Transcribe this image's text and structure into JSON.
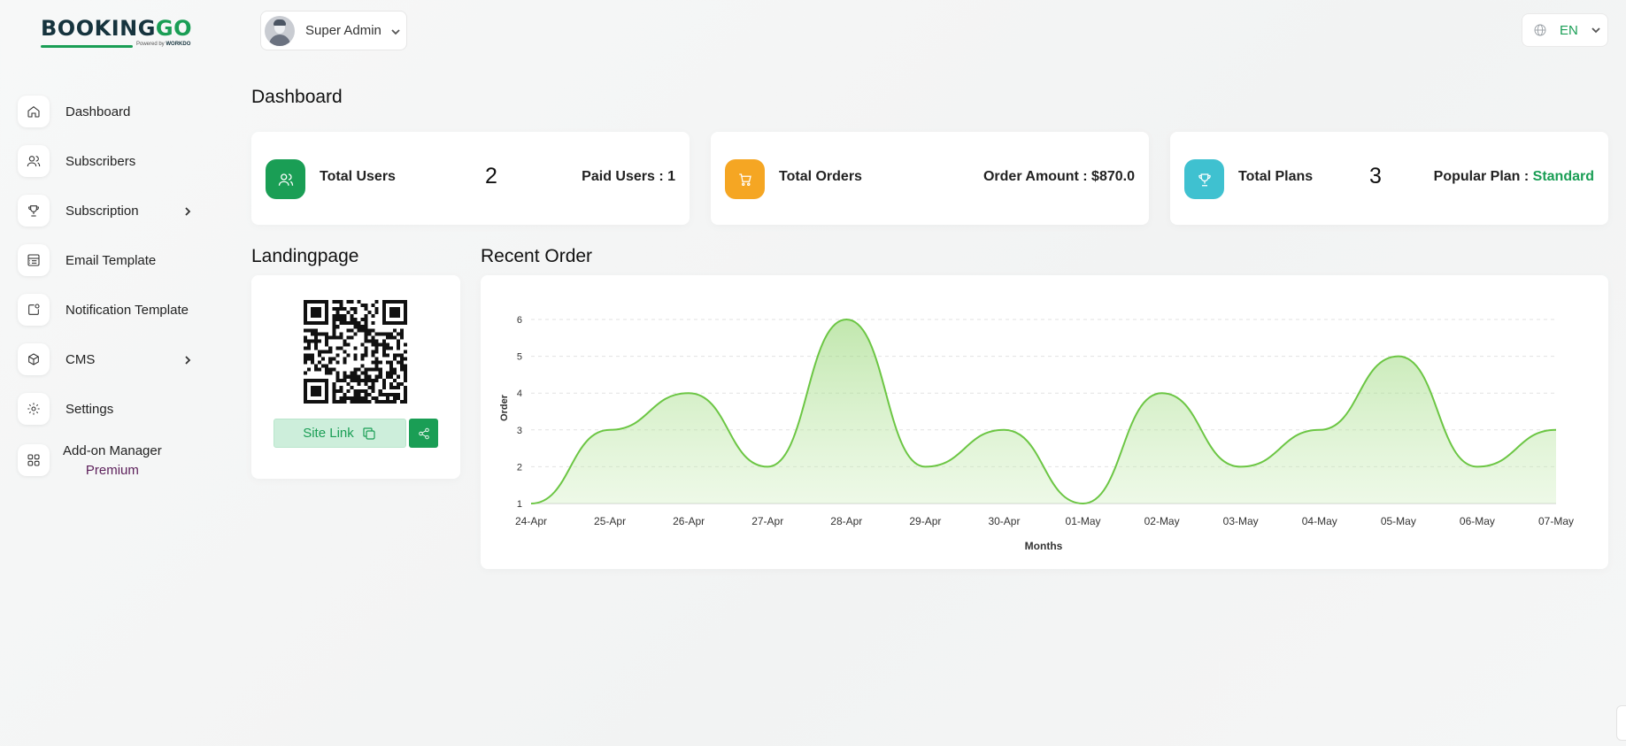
{
  "brand": {
    "logo_main": "BOOKING",
    "logo_accent": "GO",
    "powered_by": "Powered by",
    "powered_brand": "WORKDO"
  },
  "sidebar": {
    "items": [
      {
        "label": "Dashboard",
        "icon": "home-icon"
      },
      {
        "label": "Subscribers",
        "icon": "users-icon"
      },
      {
        "label": "Subscription",
        "icon": "trophy-icon",
        "has_submenu": true
      },
      {
        "label": "Email Template",
        "icon": "template-icon"
      },
      {
        "label": "Notification Template",
        "icon": "notification-icon"
      },
      {
        "label": "CMS",
        "icon": "box-icon",
        "has_submenu": true
      },
      {
        "label": "Settings",
        "icon": "gear-icon"
      }
    ],
    "addon": {
      "label": "Add-on Manager",
      "badge": "Premium",
      "icon": "grid-icon"
    }
  },
  "header": {
    "user_name": "Super Admin",
    "language": "EN"
  },
  "page_title": "Dashboard",
  "stats": {
    "users": {
      "label": "Total Users",
      "value": "2",
      "right": "Paid Users : 1",
      "color": "#1a9e55"
    },
    "orders": {
      "label": "Total Orders",
      "right": "Order Amount : $870.0",
      "color": "#f5a623"
    },
    "plans": {
      "label": "Total Plans",
      "value": "3",
      "right_prefix": "Popular Plan : ",
      "right_value": "Standard",
      "color": "#3fc1d0"
    }
  },
  "landing": {
    "title": "Landingpage",
    "site_link_label": "Site Link"
  },
  "recent_order": {
    "title": "Recent Order"
  },
  "chart_data": {
    "type": "area",
    "title": "Recent Order",
    "xlabel": "Months",
    "ylabel": "Order",
    "x": [
      "24-Apr",
      "25-Apr",
      "26-Apr",
      "27-Apr",
      "28-Apr",
      "29-Apr",
      "30-Apr",
      "01-May",
      "02-May",
      "03-May",
      "04-May",
      "05-May",
      "06-May",
      "07-May"
    ],
    "series": [
      {
        "values": [
          1,
          3,
          4,
          2,
          6,
          2,
          3,
          1,
          4,
          2,
          3,
          5,
          2,
          3
        ]
      }
    ],
    "yticks": [
      1,
      2,
      3,
      4,
      5,
      6
    ],
    "ylim": [
      1,
      6
    ],
    "grid": true,
    "color": "#6cc644"
  }
}
